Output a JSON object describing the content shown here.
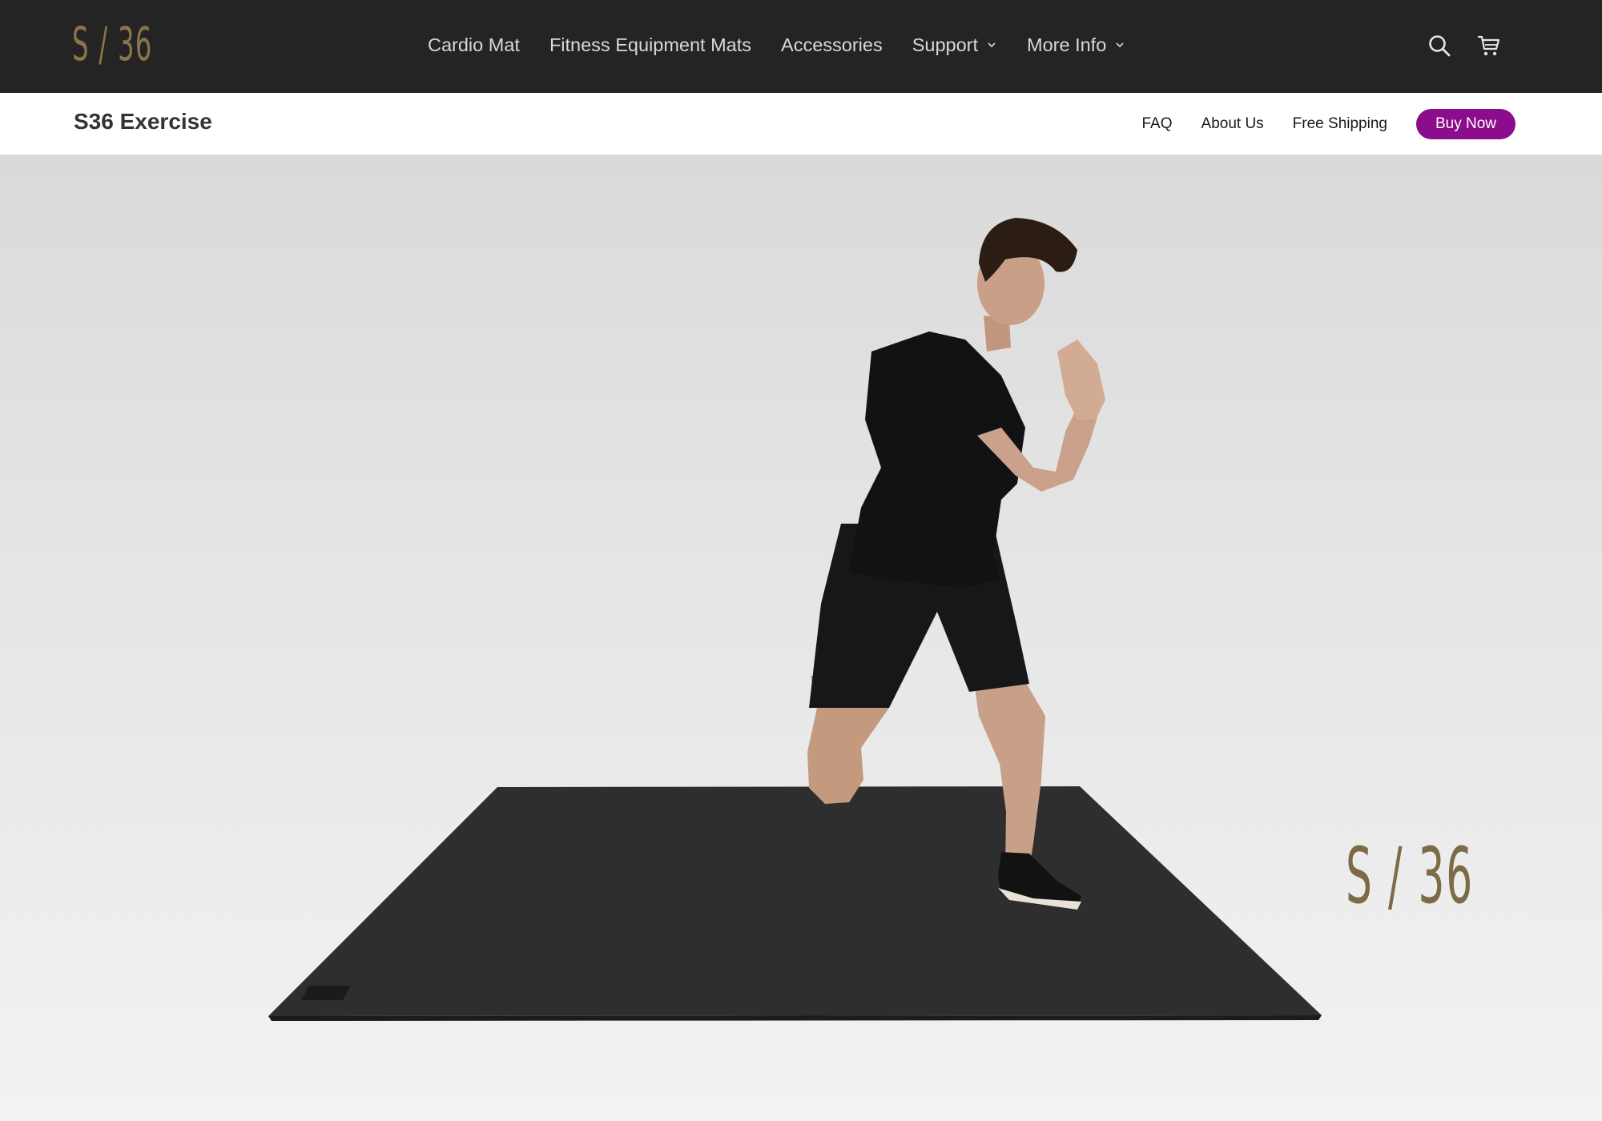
{
  "header": {
    "logo": "S / 36",
    "nav": [
      {
        "label": "Cardio Mat",
        "dropdown": false
      },
      {
        "label": "Fitness Equipment Mats",
        "dropdown": false
      },
      {
        "label": "Accessories",
        "dropdown": false
      },
      {
        "label": "Support",
        "dropdown": true
      },
      {
        "label": "More Info",
        "dropdown": true
      }
    ],
    "icons": [
      "search-icon",
      "cart-icon"
    ]
  },
  "subheader": {
    "title": "S36 Exercise",
    "links": [
      "FAQ",
      "About Us",
      "Free Shipping"
    ],
    "cta": "Buy Now"
  },
  "hero": {
    "logo": "S / 36"
  },
  "colors": {
    "topbar": "#242424",
    "logo_gold": "#897549",
    "cta_purple": "#8b0d8b"
  }
}
